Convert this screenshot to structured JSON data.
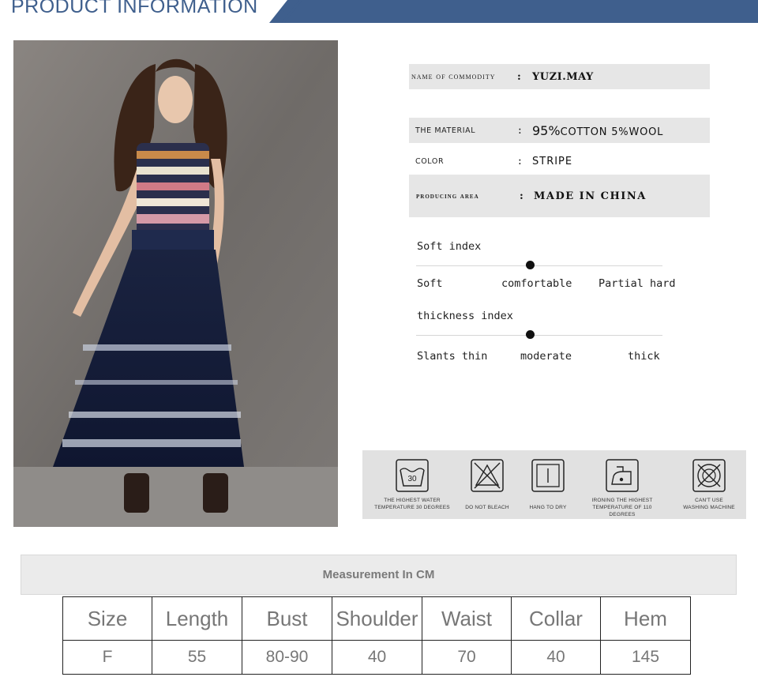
{
  "header": {
    "title": "PRODUCT INFORMATION",
    "colors": {
      "band": "#3f5f8d",
      "title": "#3f5f8d"
    }
  },
  "photo": {
    "alt_icon": "model-photo"
  },
  "info": {
    "name": {
      "label": "name of commodity",
      "sep": ":",
      "value": "YUZI.MAY"
    },
    "material": {
      "label": "THE MATERIAL",
      "sep": ":",
      "value_big": "95%",
      "value_rest": "COTTON 5%WOOL"
    },
    "color": {
      "label": "COLOR",
      "sep": ":",
      "value": "STRIPE"
    },
    "area": {
      "label": "producing area",
      "sep": ":",
      "value": "MADE IN CHINA"
    }
  },
  "soft_index": {
    "title": "Soft index",
    "labels": [
      "Soft",
      "comfortable",
      "Partial hard"
    ],
    "level": 0.5
  },
  "thickness_index": {
    "title": "thickness index",
    "labels": [
      "Slants thin",
      "moderate",
      "thick"
    ],
    "level": 0.5
  },
  "care": {
    "items": [
      {
        "icon": "wash-30-icon",
        "temp": "30",
        "caption": [
          "THE HIGHEST WATER",
          "TEMPERATURE 30 DEGREES"
        ]
      },
      {
        "icon": "no-bleach-icon",
        "caption": [
          "DO NOT BLEACH"
        ]
      },
      {
        "icon": "hang-dry-icon",
        "caption": [
          "HANG TO DRY"
        ]
      },
      {
        "icon": "iron-icon",
        "caption": [
          "IRONING THE HIGHEST",
          "TEMPERATURE OF 110 DEGREES"
        ]
      },
      {
        "icon": "no-machine-wash-icon",
        "caption": [
          "CAN'T USE",
          "WASHING MACHINE"
        ]
      }
    ]
  },
  "measurement": {
    "title": "Measurement In CM",
    "headers": [
      "Size",
      "Length",
      "Bust",
      "Shoulder",
      "Waist",
      "Collar",
      "Hem"
    ],
    "rows": [
      [
        "F",
        "55",
        "80-90",
        "40",
        "70",
        "40",
        "145"
      ]
    ]
  }
}
